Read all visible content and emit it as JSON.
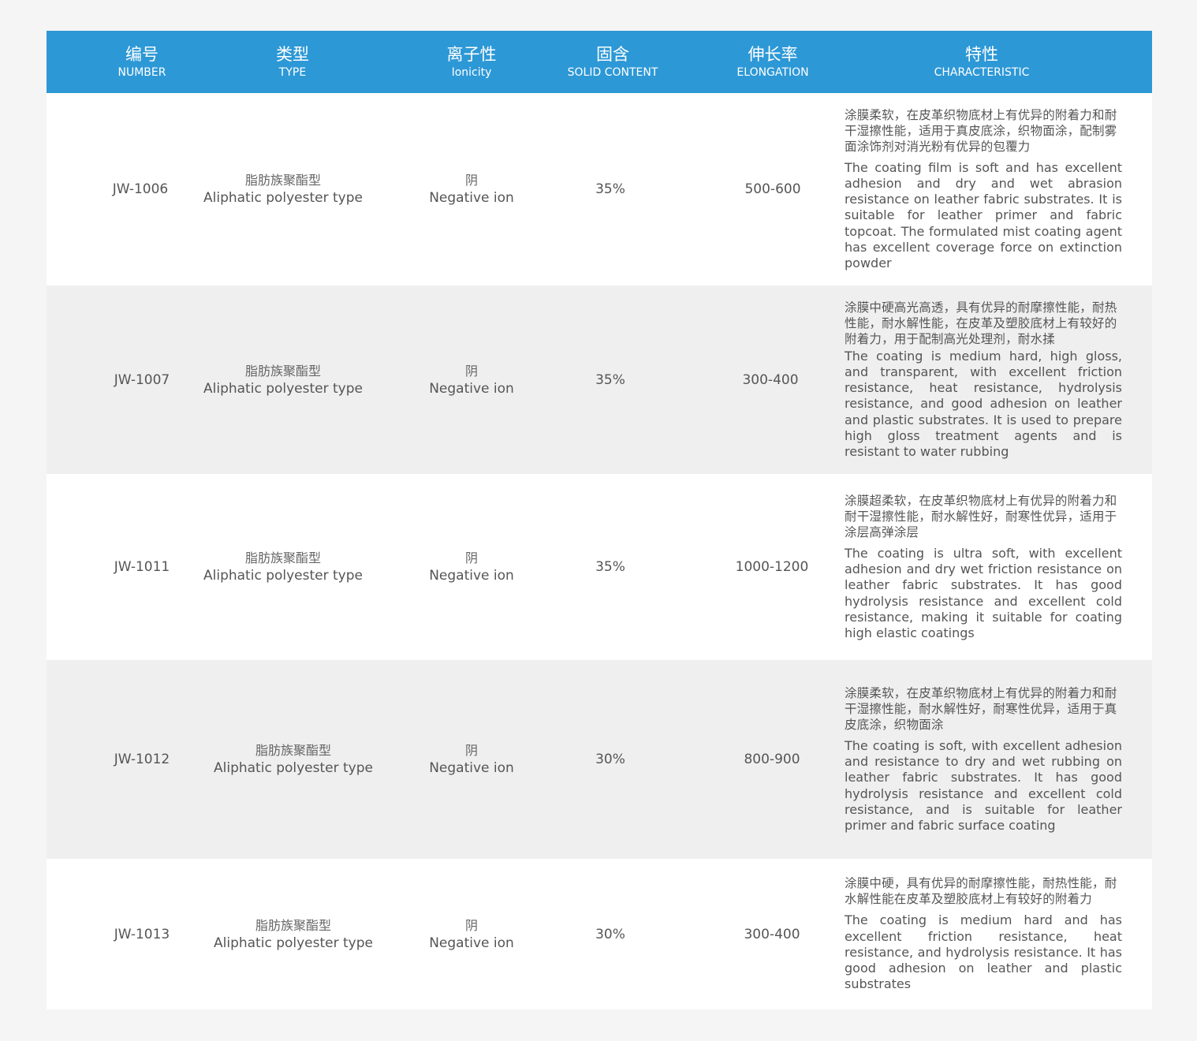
{
  "header": {
    "number": {
      "zh": "编号",
      "en": "NUMBER"
    },
    "type": {
      "zh": "类型",
      "en": "TYPE"
    },
    "ionicity": {
      "zh": "离子性",
      "en": "Ionicity"
    },
    "solid": {
      "zh": "固含",
      "en": "SOLID CONTENT"
    },
    "elongation": {
      "zh": "伸长率",
      "en": "ELONGATION"
    },
    "characteristic": {
      "zh": "特性",
      "en": "CHARACTERISTIC"
    }
  },
  "rows": [
    {
      "number": "JW-1006",
      "type_zh": "脂肪族聚酯型",
      "type_en": "Aliphatic polyester type",
      "ion_zh": "阴",
      "ion_en": "Negative ion",
      "solid": "35%",
      "elongation": "500-600",
      "char_zh": "涂膜柔软，在皮革织物底材上有优异的附着力和耐干湿擦性能，适用于真皮底涂，织物面涂，配制雾面涂饰剂对消光粉有优异的包覆力",
      "char_en": "The coating film is soft and has excellent adhesion and dry and wet abrasion resistance on leather fabric substrates. It is suitable for leather primer and fabric topcoat. The formulated mist coating agent has excellent coverage force on extinction powder"
    },
    {
      "number": "JW-1007",
      "type_zh": "脂肪族聚酯型",
      "type_en": "Aliphatic polyester type",
      "ion_zh": "阴",
      "ion_en": "Negative ion",
      "solid": "35%",
      "elongation": "300-400",
      "char_zh": "涂膜中硬高光高透，具有优异的耐摩擦性能，耐热性能，耐水解性能，在皮革及塑胶底材上有较好的附着力，用于配制高光处理剂，耐水揉",
      "char_en": "The coating is medium hard, high gloss, and transparent, with excellent friction resistance, heat resistance, hydrolysis resistance, and good adhesion on leather and plastic substrates. It is used to prepare high gloss treatment agents and is resistant to water rubbing"
    },
    {
      "number": "JW-1011",
      "type_zh": "脂肪族聚酯型",
      "type_en": "Aliphatic polyester type",
      "ion_zh": "阴",
      "ion_en": "Negative ion",
      "solid": "35%",
      "elongation": "1000-1200",
      "char_zh": "涂膜超柔软，在皮革织物底材上有优异的附着力和耐干湿擦性能，耐水解性好，耐寒性优异，适用于涂层高弹涂层",
      "char_en": "The coating is ultra soft, with excellent adhesion and dry wet friction resistance on leather fabric substrates. It has good hydrolysis resistance and excellent cold resistance, making it suitable for coating high elastic coatings"
    },
    {
      "number": "JW-1012",
      "type_zh": "脂肪族聚酯型",
      "type_en": "Aliphatic polyester type",
      "ion_zh": "阴",
      "ion_en": "Negative ion",
      "solid": "30%",
      "elongation": "800-900",
      "char_zh": "涂膜柔软，在皮革织物底材上有优异的附着力和耐干湿擦性能，耐水解性好，耐寒性优异，适用于真皮底涂，织物面涂",
      "char_en": "The coating is soft, with excellent adhesion and resistance to dry and wet rubbing on leather fabric substrates. It has good hydrolysis resistance and excellent cold resistance, and is suitable for leather primer and fabric surface coating"
    },
    {
      "number": "JW-1013",
      "type_zh": "脂肪族聚酯型",
      "type_en": "Aliphatic polyester type",
      "ion_zh": "阴",
      "ion_en": "Negative ion",
      "solid": "30%",
      "elongation": "300-400",
      "char_zh": "涂膜中硬，具有优异的耐摩擦性能，耐热性能，耐水解性能在皮革及塑胶底材上有较好的附着力",
      "char_en": "The coating is medium hard and has excellent friction resistance, heat resistance, and hydrolysis resistance. It has good adhesion on leather and plastic substrates"
    }
  ]
}
